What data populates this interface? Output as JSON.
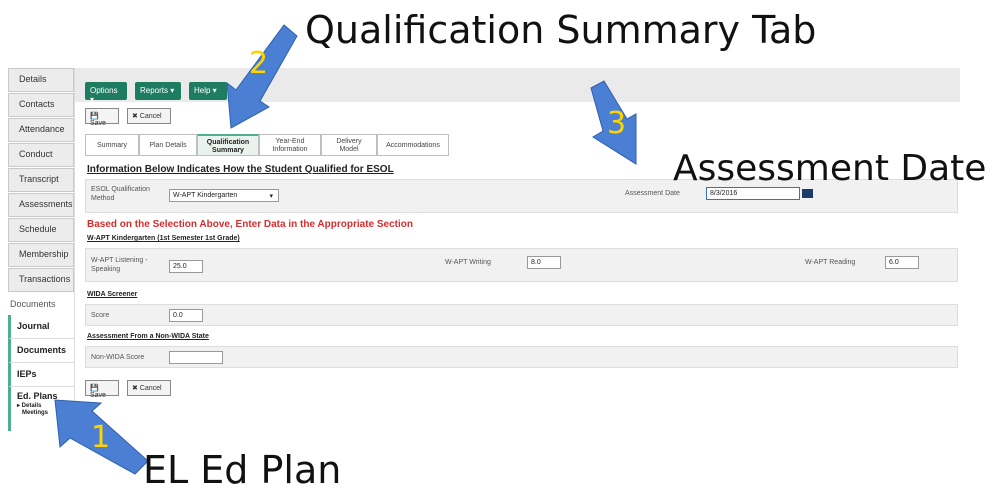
{
  "annotations": {
    "title_qual": "Qualification Summary Tab",
    "title_assess": "Assessment Date",
    "title_el": "EL Ed Plan",
    "num1": "1",
    "num2": "2",
    "num3": "3"
  },
  "sidebar": {
    "items": [
      "Details",
      "Contacts",
      "Attendance",
      "Conduct",
      "Transcript",
      "Assessments",
      "Schedule",
      "Membership",
      "Transactions"
    ],
    "documents_header": "Documents",
    "journal": "Journal",
    "documents": "Documents",
    "ieps": "IEPs",
    "ed_plans": "Ed. Plans",
    "ed_details": "▸ Details",
    "ed_meetings": "Meetings"
  },
  "toolbar": {
    "options": "Options ▾",
    "reports": "Reports ▾",
    "help": "Help ▾",
    "save": "💾 Save",
    "cancel": "✖ Cancel"
  },
  "tabs": {
    "summary": "Summary",
    "plan_details": "Plan Details",
    "qual_1": "Qualification",
    "qual_2": "Summary",
    "year_1": "Year-End",
    "year_2": "Information",
    "delivery_1": "Delivery",
    "delivery_2": "Model",
    "accommodations": "Accommodations"
  },
  "form": {
    "section_title": "Information Below Indicates How the Student Qualified for ESOL",
    "esol_label_1": "ESOL Qualification",
    "esol_label_2": "Method",
    "esol_value": "W-APT Kindergarten",
    "assessment_label": "Assessment Date",
    "assessment_value": "8/3/2016",
    "instruction": "Based on the Selection Above, Enter Data in the Appropriate Section",
    "wapt_header": "W-APT Kindergarten (1st Semester 1st Grade)",
    "listening_label_1": "W-APT Listening -",
    "listening_label_2": "Speaking",
    "listening_value": "25.0",
    "writing_label": "W-APT Writing",
    "writing_value": "8.0",
    "reading_label": "W-APT Reading",
    "reading_value": "6.0",
    "wida_header": "WIDA Screener",
    "score_label": "Score",
    "score_value": "0.0",
    "nonwida_header": "Assessment From a Non-WIDA State",
    "nonwida_label": "Non-WIDA Score",
    "nonwida_value": ""
  },
  "colors": {
    "accent_green": "#1e7d61",
    "arrow_blue": "#4a7fd4",
    "number_yellow": "#ffd400",
    "instruction_red": "#d32f2f"
  }
}
